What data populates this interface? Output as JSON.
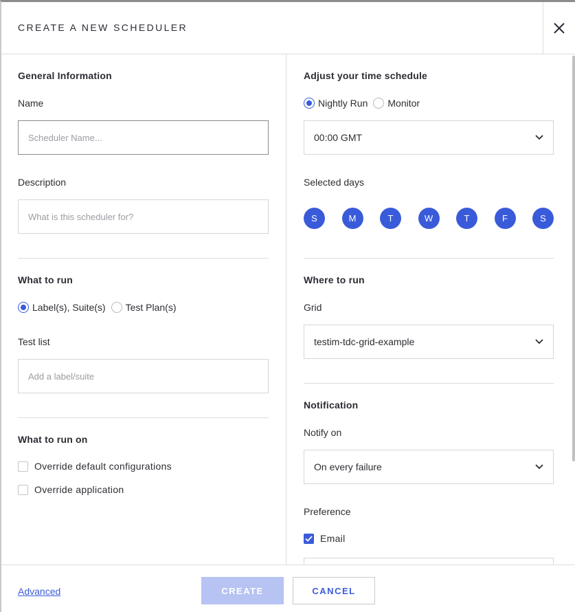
{
  "header": {
    "title": "CREATE A NEW SCHEDULER"
  },
  "general": {
    "title": "General Information",
    "name_label": "Name",
    "name_placeholder": "Scheduler Name...",
    "description_label": "Description",
    "description_placeholder": "What is this scheduler for?"
  },
  "what_to_run": {
    "title": "What to run",
    "options": [
      "Label(s), Suite(s)",
      "Test Plan(s)"
    ],
    "selected": "Label(s), Suite(s)",
    "test_list_label": "Test list",
    "test_list_placeholder": "Add a label/suite"
  },
  "what_to_run_on": {
    "title": "What to run on",
    "checkboxes": [
      {
        "label": "Override default configurations",
        "checked": false
      },
      {
        "label": "Override application",
        "checked": false
      }
    ]
  },
  "schedule": {
    "title": "Adjust your time schedule",
    "options": [
      "Nightly Run",
      "Monitor"
    ],
    "selected": "Nightly Run",
    "time_value": "00:00 GMT",
    "days_label": "Selected days",
    "days": [
      "S",
      "M",
      "T",
      "W",
      "T",
      "F",
      "S"
    ]
  },
  "where_to_run": {
    "title": "Where to run",
    "grid_label": "Grid",
    "grid_value": "testim-tdc-grid-example"
  },
  "notification": {
    "title": "Notification",
    "notify_label": "Notify on",
    "notify_value": "On every failure",
    "preference_label": "Preference",
    "email_label": "Email",
    "email_checked": true
  },
  "footer": {
    "advanced_label": "Advanced",
    "create_label": "CREATE",
    "cancel_label": "CANCEL"
  },
  "colors": {
    "accent": "#3a5bd9",
    "create_disabled": "#b7c3f2",
    "border": "#dcdcdc"
  }
}
